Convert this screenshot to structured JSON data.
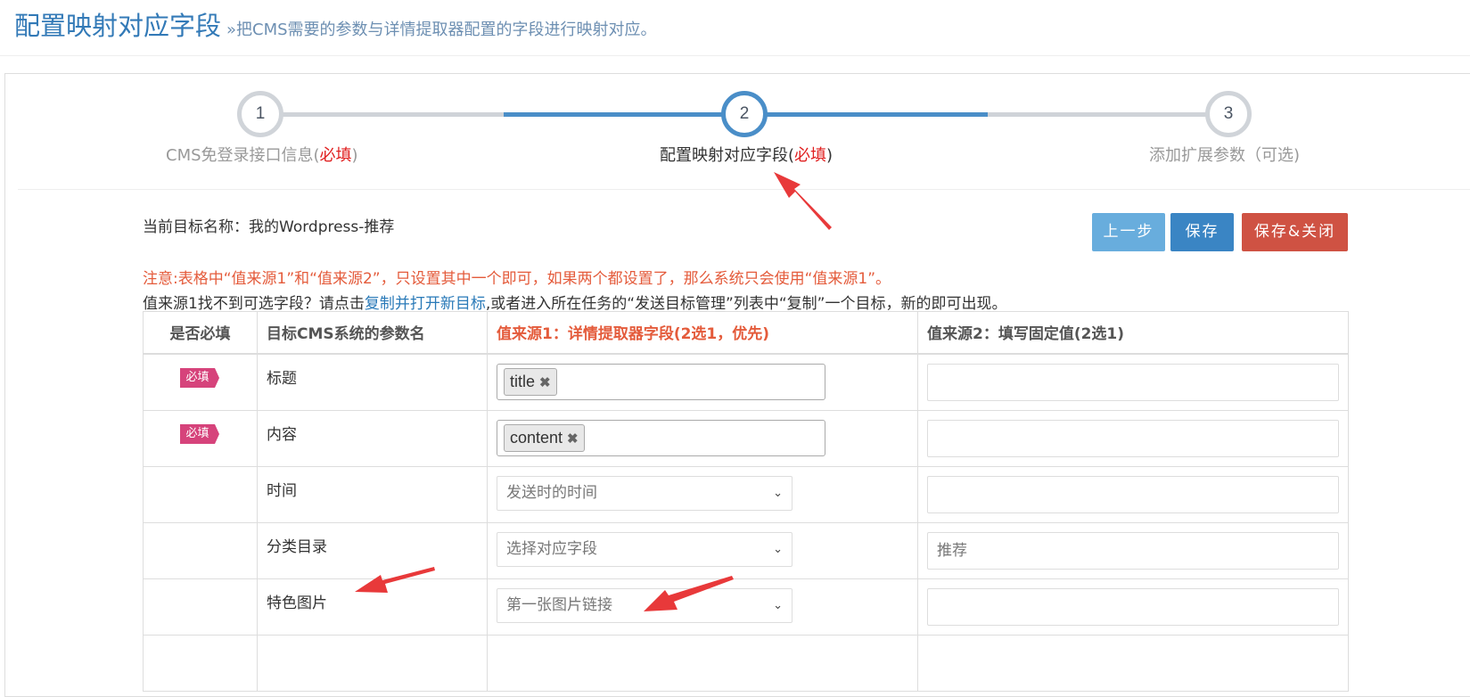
{
  "header": {
    "title": "配置映射对应字段",
    "subtitle": "»把CMS需要的参数与详情提取器配置的字段进行映射对应。"
  },
  "wizard": {
    "steps": [
      {
        "number": "1",
        "label": "CMS免登录接口信息(",
        "required": "必填",
        "suffix": ")"
      },
      {
        "number": "2",
        "label": "配置映射对应字段(",
        "required": "必填",
        "suffix": ")"
      },
      {
        "number": "3",
        "label": "添加扩展参数（可选)",
        "required": "",
        "suffix": ""
      }
    ],
    "active_step": 2
  },
  "target": {
    "label": "当前目标名称：我的Wordpress-推荐"
  },
  "buttons": {
    "prev": "上一步",
    "save": "保存",
    "save_close": "保存&关闭"
  },
  "notice": "注意:表格中“值来源1”和“值来源2”，只设置其中一个即可，如果两个都设置了，那么系统只会使用“值来源1”。",
  "hint": {
    "before": "值来源1找不到可选字段？请点击",
    "link": "复制并打开新目标",
    "after": ",或者进入所在任务的“发送目标管理”列表中“复制”一个目标，新的即可出现。"
  },
  "table": {
    "headers": {
      "required": "是否必填",
      "param": "目标CMS系统的参数名",
      "source1": "值来源1：详情提取器字段(2选1，优先)",
      "source2": "值来源2：填写固定值(2选1)"
    },
    "required_badge": "必填",
    "rows": [
      {
        "name": "标题",
        "tag": "title",
        "select": "",
        "fixed": ""
      },
      {
        "name": "内容",
        "tag": "content",
        "select": "",
        "fixed": ""
      },
      {
        "name": "时间",
        "tag": "",
        "select": "发送时的时间",
        "fixed": ""
      },
      {
        "name": "分类目录",
        "tag": "",
        "select": "选择对应字段",
        "fixed": "推荐"
      },
      {
        "name": "特色图片",
        "tag": "",
        "select": "第一张图片链接",
        "fixed": ""
      }
    ]
  },
  "colors": {
    "primary": "#337ab7",
    "step_active": "#4a8ec8",
    "danger": "#cf5243",
    "notice": "#e45b3b",
    "badge": "#d6437b",
    "annotation_arrow": "#e8393a"
  }
}
